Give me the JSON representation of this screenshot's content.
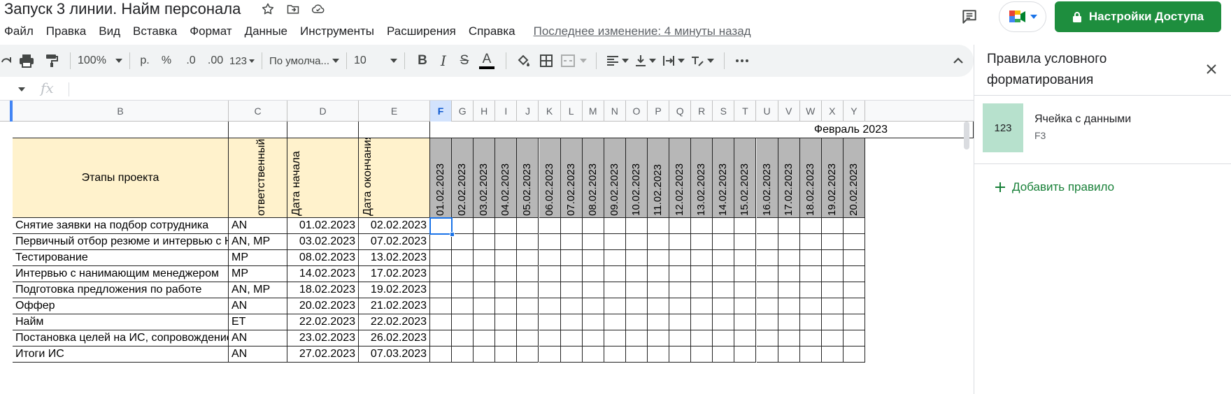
{
  "header": {
    "title": "Запуск 3 линии. Найм персонала",
    "share_label": "Настройки Доступа"
  },
  "menu": {
    "items": [
      "Файл",
      "Правка",
      "Вид",
      "Вставка",
      "Формат",
      "Данные",
      "Инструменты",
      "Расширения",
      "Справка"
    ],
    "last_edit": "Последнее изменение: 4 минуты назад"
  },
  "toolbar": {
    "zoom": "100%",
    "currency": "р.",
    "percent": "%",
    "decrease_decimals": ".0",
    "increase_decimals": ".00",
    "number_format": "123",
    "font": "По умолча...",
    "font_size": "10",
    "bold": "B",
    "italic": "I",
    "strikethrough": "S",
    "text_color": "A"
  },
  "formula_bar": {
    "fx_label": "fx",
    "value": ""
  },
  "sheet": {
    "columns": [
      "B",
      "C",
      "D",
      "E",
      "F",
      "G",
      "H",
      "I",
      "J",
      "K",
      "L",
      "M",
      "N",
      "O",
      "P",
      "Q",
      "R",
      "S",
      "T",
      "U",
      "V",
      "W",
      "X",
      "Y"
    ],
    "month_label": "Февраль 2023",
    "headers": {
      "stages": "Этапы проекта",
      "responsible": "ответственный",
      "start_date": "Дата начала",
      "end_date": "Дата окончания"
    },
    "dates": [
      "01.02.2023",
      "02.02.2023",
      "03.02.2023",
      "04.02.2023",
      "05.02.2023",
      "06.02.2023",
      "07.02.2023",
      "08.02.2023",
      "09.02.2023",
      "10.02.2023",
      "11.02.2023",
      "12.02.2023",
      "13.02.2023",
      "14.02.2023",
      "15.02.2023",
      "16.02.2023",
      "17.02.2023",
      "18.02.2023",
      "19.02.2023",
      "20.02.2023"
    ],
    "rows": [
      {
        "stage": "Снятие заявки на подбор сотрудника",
        "owner": "AN",
        "start": "01.02.2023",
        "end": "02.02.2023"
      },
      {
        "stage": "Первичный отбор резюме и интервью с HR",
        "owner": "AN, MP",
        "start": "03.02.2023",
        "end": "07.02.2023"
      },
      {
        "stage": "Тестирование",
        "owner": "MP",
        "start": "08.02.2023",
        "end": "13.02.2023"
      },
      {
        "stage": "Интервью с нанимающим менеджером",
        "owner": "MP",
        "start": "14.02.2023",
        "end": "17.02.2023"
      },
      {
        "stage": "Подготовка предложения по работе",
        "owner": "AN, MP",
        "start": "18.02.2023",
        "end": "19.02.2023"
      },
      {
        "stage": "Оффер",
        "owner": "AN",
        "start": "20.02.2023",
        "end": "21.02.2023"
      },
      {
        "stage": "Найм",
        "owner": "ET",
        "start": "22.02.2023",
        "end": "22.02.2023"
      },
      {
        "stage": "Постановка целей на ИС, сопровождение адаптации",
        "owner": "AN",
        "start": "23.02.2023",
        "end": "26.02.2023"
      },
      {
        "stage": "Итоги ИС",
        "owner": "AN",
        "start": "27.02.2023",
        "end": "07.03.2023"
      }
    ]
  },
  "side_panel": {
    "title": "Правила условного форматирования",
    "rule": {
      "swatch_text": "123",
      "name": "Ячейка с данными",
      "range": "F3"
    },
    "add_rule_label": "Добавить правило"
  },
  "colors": {
    "accent_green": "#1e8e3e",
    "header_yellow": "#fff2cc",
    "date_gray": "#b7b7b7",
    "rule_swatch": "#b7e1cd",
    "selection_blue": "#1a73e8"
  }
}
